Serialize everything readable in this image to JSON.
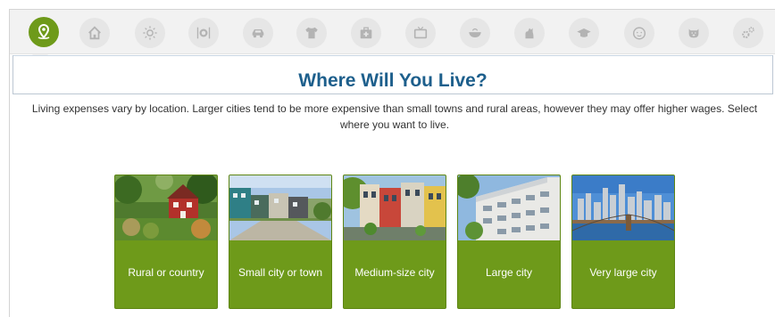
{
  "nav": {
    "icons": [
      {
        "name": "location-pin-icon",
        "active": true
      },
      {
        "name": "house-icon"
      },
      {
        "name": "sun-icon"
      },
      {
        "name": "dining-icon"
      },
      {
        "name": "car-icon"
      },
      {
        "name": "shirt-icon"
      },
      {
        "name": "medical-kit-icon"
      },
      {
        "name": "tv-icon"
      },
      {
        "name": "bowl-icon"
      },
      {
        "name": "pet-icon"
      },
      {
        "name": "graduation-cap-icon"
      },
      {
        "name": "baby-face-icon"
      },
      {
        "name": "piggy-bank-icon"
      },
      {
        "name": "settings-gears-icon"
      }
    ],
    "active_color": "#6e9a1a",
    "inactive_color": "#e6e6e6"
  },
  "page": {
    "title": "Where Will You Live?",
    "intro": "Living expenses vary by location. Larger cities tend to be more expensive than small towns and rural areas, however they may offer higher wages. Select where you want to live."
  },
  "options": [
    {
      "label": "Rural or country",
      "image": "red-farmhouse-photo"
    },
    {
      "label": "Small city or town",
      "image": "modern-townhouses-photo"
    },
    {
      "label": "Medium-size city",
      "image": "colorful-rowhouses-photo"
    },
    {
      "label": "Large city",
      "image": "apartment-block-photo"
    },
    {
      "label": "Very large city",
      "image": "skyline-bridge-photo"
    }
  ],
  "colors": {
    "card_green": "#6e9a1a",
    "title_blue": "#1d5f8c"
  }
}
